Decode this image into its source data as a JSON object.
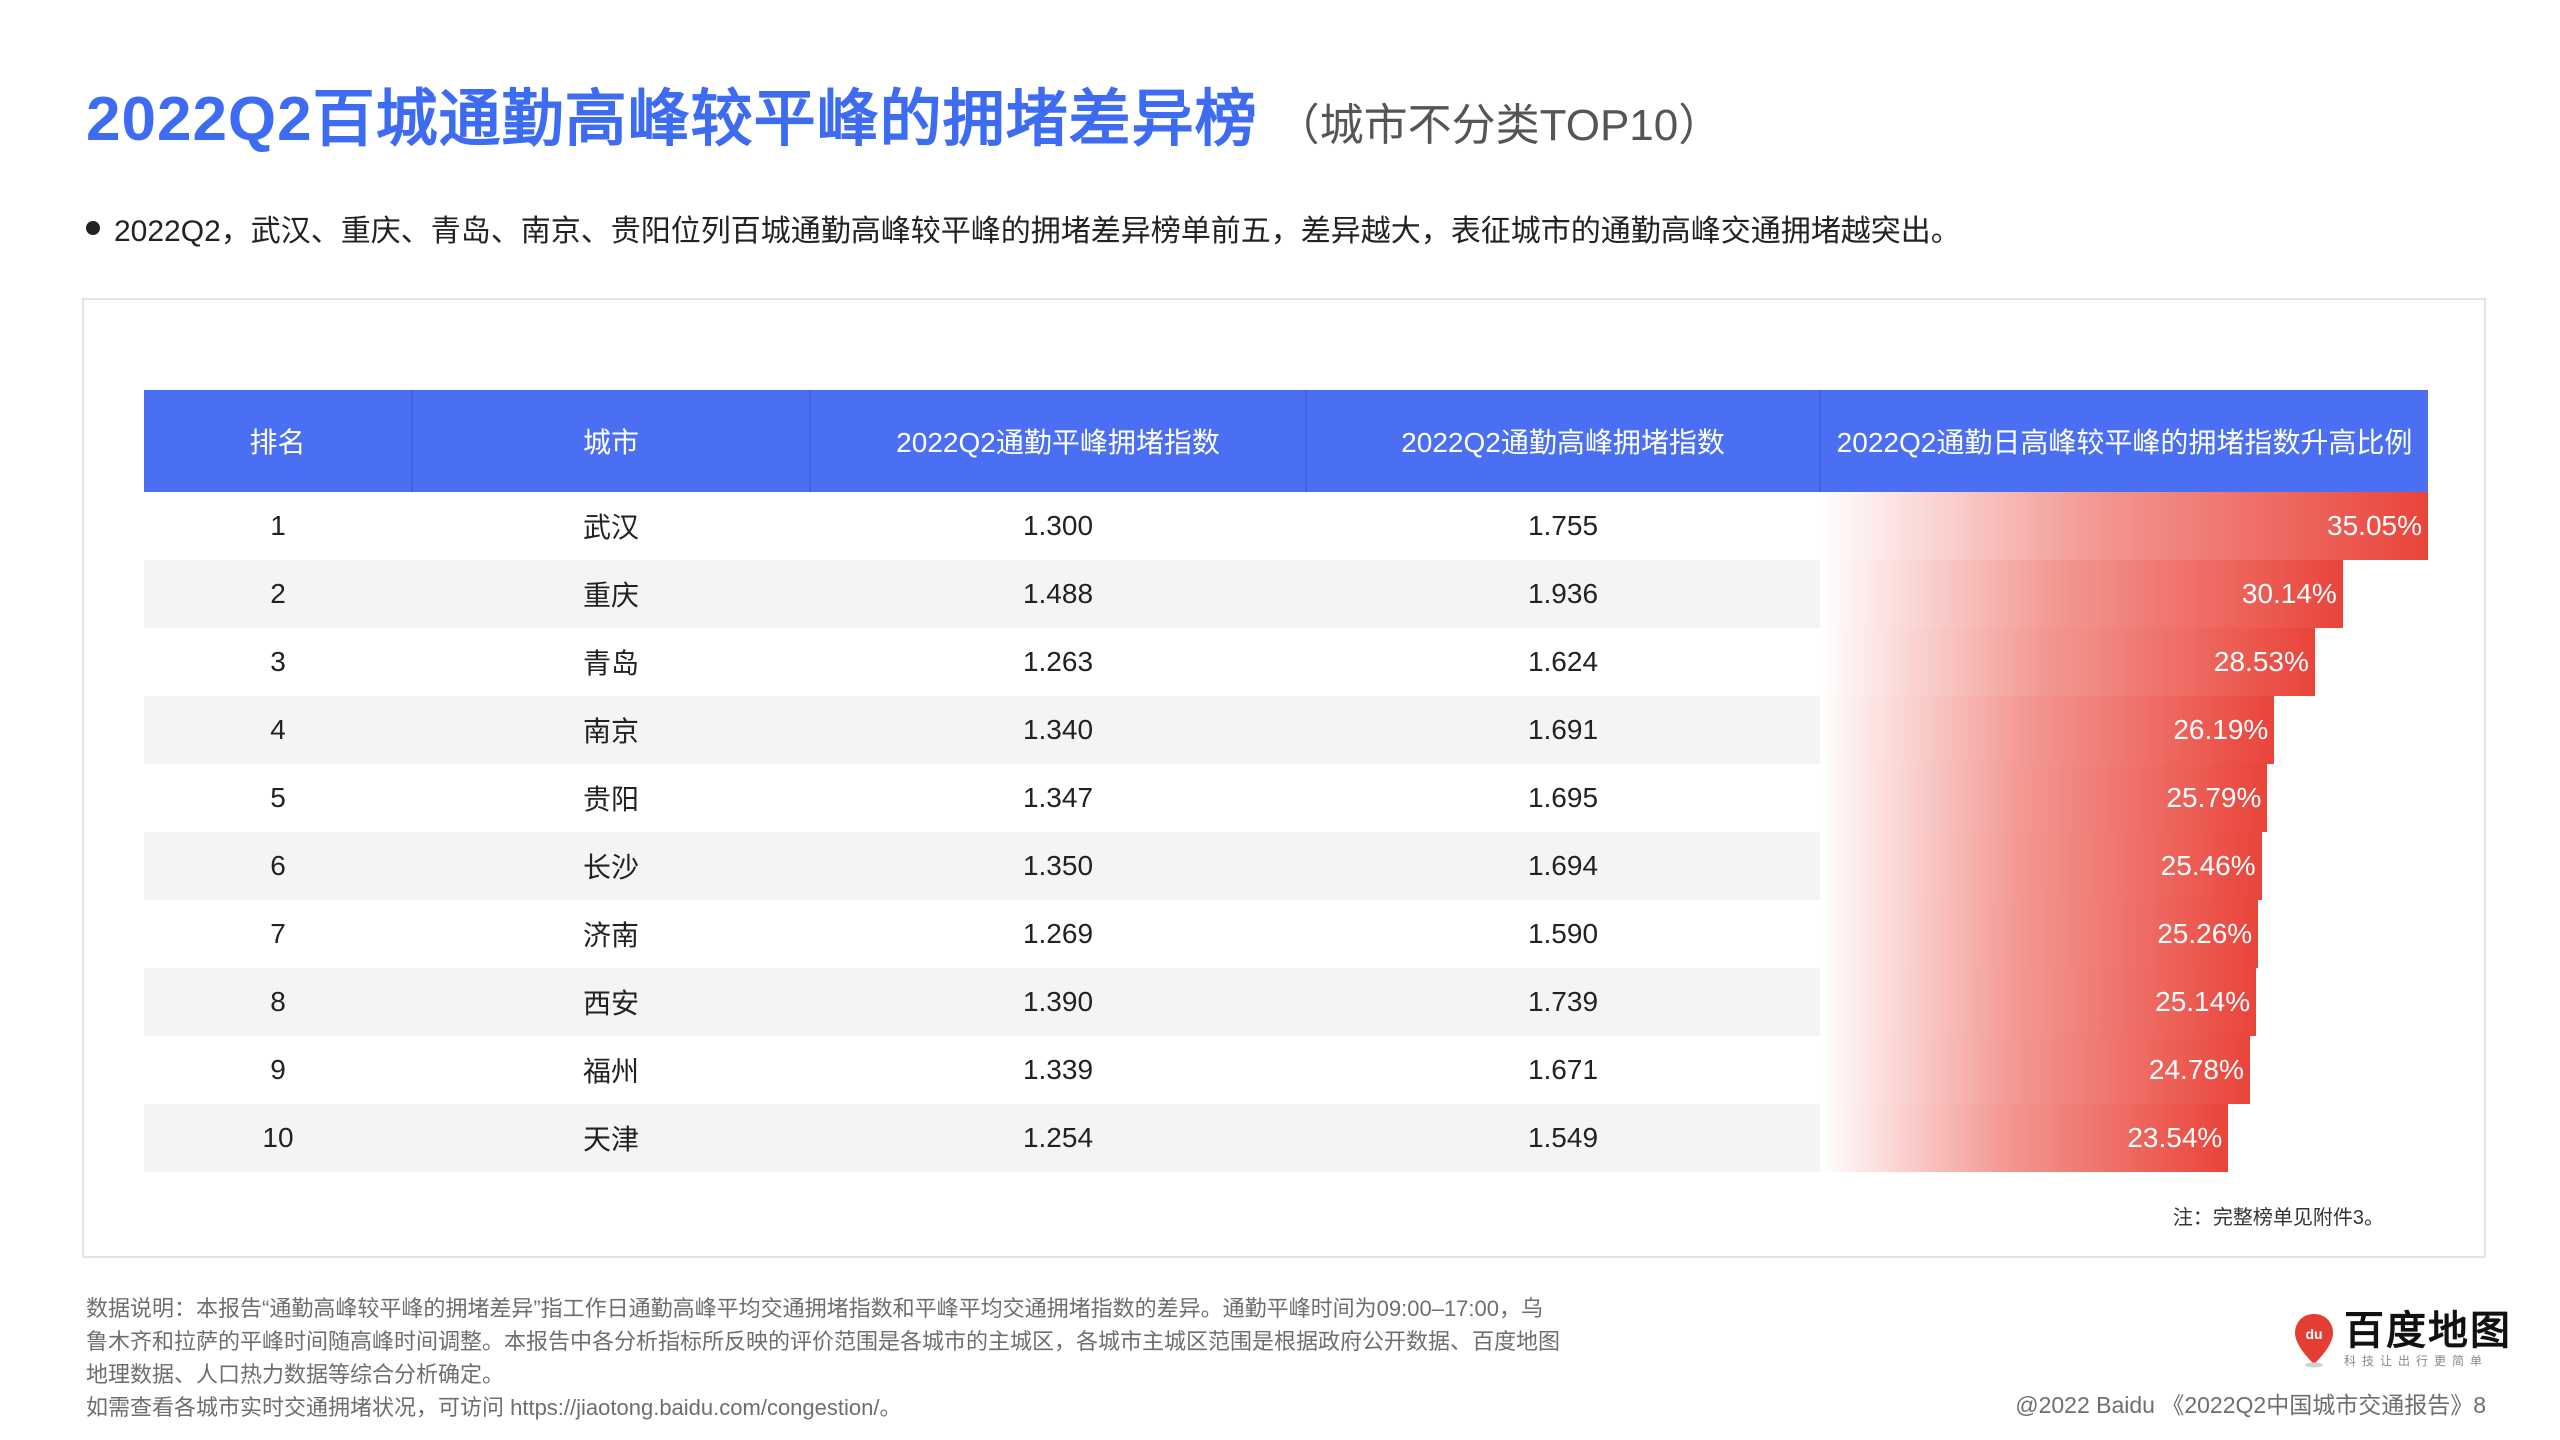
{
  "header": {
    "title": "2022Q2百城通勤高峰较平峰的拥堵差异榜",
    "subtitle": "（城市不分类TOP10）"
  },
  "bullet": "2022Q2，武汉、重庆、青岛、南京、贵阳位列百城通勤高峰较平峰的拥堵差异榜单前五，差异越大，表征城市的通勤高峰交通拥堵越突出。",
  "table": {
    "columns": [
      "排名",
      "城市",
      "2022Q2通勤平峰拥堵指数",
      "2022Q2通勤高峰拥堵指数",
      "2022Q2通勤日高峰较平峰的拥堵指数升高比例"
    ],
    "rows": [
      {
        "rank": "1",
        "city": "武汉",
        "offpeak": "1.300",
        "peak": "1.755",
        "ratio": "35.05%",
        "ratio_value": 35.05
      },
      {
        "rank": "2",
        "city": "重庆",
        "offpeak": "1.488",
        "peak": "1.936",
        "ratio": "30.14%",
        "ratio_value": 30.14
      },
      {
        "rank": "3",
        "city": "青岛",
        "offpeak": "1.263",
        "peak": "1.624",
        "ratio": "28.53%",
        "ratio_value": 28.53
      },
      {
        "rank": "4",
        "city": "南京",
        "offpeak": "1.340",
        "peak": "1.691",
        "ratio": "26.19%",
        "ratio_value": 26.19
      },
      {
        "rank": "5",
        "city": "贵阳",
        "offpeak": "1.347",
        "peak": "1.695",
        "ratio": "25.79%",
        "ratio_value": 25.79
      },
      {
        "rank": "6",
        "city": "长沙",
        "offpeak": "1.350",
        "peak": "1.694",
        "ratio": "25.46%",
        "ratio_value": 25.46
      },
      {
        "rank": "7",
        "city": "济南",
        "offpeak": "1.269",
        "peak": "1.590",
        "ratio": "25.26%",
        "ratio_value": 25.26
      },
      {
        "rank": "8",
        "city": "西安",
        "offpeak": "1.390",
        "peak": "1.739",
        "ratio": "25.14%",
        "ratio_value": 25.14
      },
      {
        "rank": "9",
        "city": "福州",
        "offpeak": "1.339",
        "peak": "1.671",
        "ratio": "24.78%",
        "ratio_value": 24.78
      },
      {
        "rank": "10",
        "city": "天津",
        "offpeak": "1.254",
        "peak": "1.549",
        "ratio": "23.54%",
        "ratio_value": 23.54
      }
    ],
    "note": "注：完整榜单见附件3。"
  },
  "footnote": [
    "数据说明：本报告“通勤高峰较平峰的拥堵差异”指工作日通勤高峰平均交通拥堵指数和平峰平均交通拥堵指数的差异。通勤平峰时间为09:00–17:00，乌",
    "鲁木齐和拉萨的平峰时间随高峰时间调整。本报告中各分析指标所反映的评价范围是各城市的主城区，各城市主城区范围是根据政府公开数据、百度地图",
    "地理数据、人口热力数据等综合分析确定。",
    "如需查看各城市实时交通拥堵状况，可访问 https://jiaotong.baidu.com/congestion/。"
  ],
  "logo": {
    "name": "百度地图",
    "tagline": "科技让出行更简单",
    "pin_text": "du"
  },
  "copyright": "@2022 Baidu 《2022Q2中国城市交通报告》8",
  "colors": {
    "title_blue": "#3d6cf2",
    "header_blue": "#4a6ff2",
    "bar_red": "#e9443a"
  },
  "bar_scale_max": 35.05
}
